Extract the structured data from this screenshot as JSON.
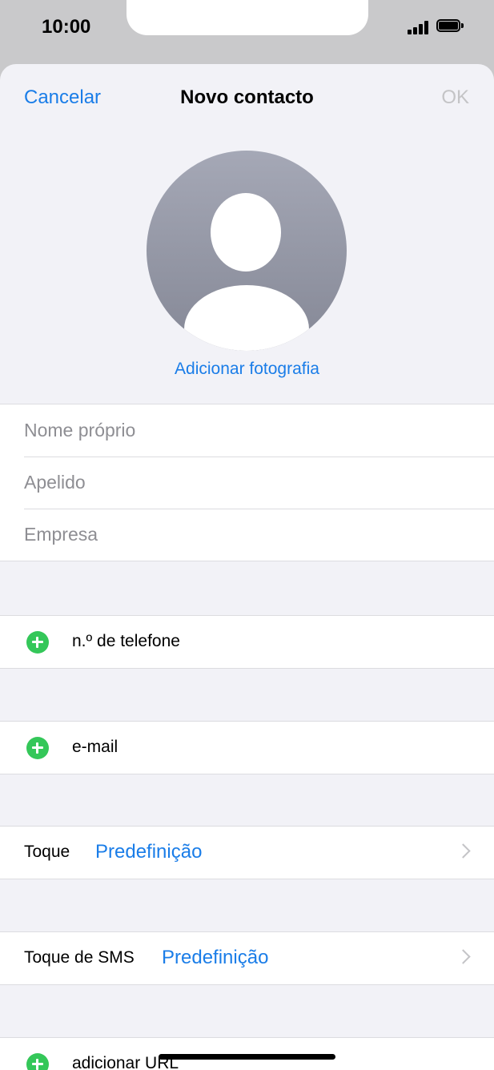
{
  "status": {
    "time": "10:00"
  },
  "nav": {
    "cancel": "Cancelar",
    "title": "Novo contacto",
    "ok": "OK"
  },
  "photo": {
    "add_label": "Adicionar fotografia"
  },
  "name_fields": {
    "first_name_placeholder": "Nome próprio",
    "last_name_placeholder": "Apelido",
    "company_placeholder": "Empresa"
  },
  "add_items": {
    "phone": "n.º de telefone",
    "email": "e-mail",
    "url": "adicionar URL"
  },
  "ringtone": {
    "label": "Toque",
    "value": "Predefinição"
  },
  "text_tone": {
    "label": "Toque de SMS",
    "value": "Predefinição"
  },
  "colors": {
    "accent": "#1a7de8",
    "add_green": "#34c759",
    "background": "#f2f2f7"
  }
}
